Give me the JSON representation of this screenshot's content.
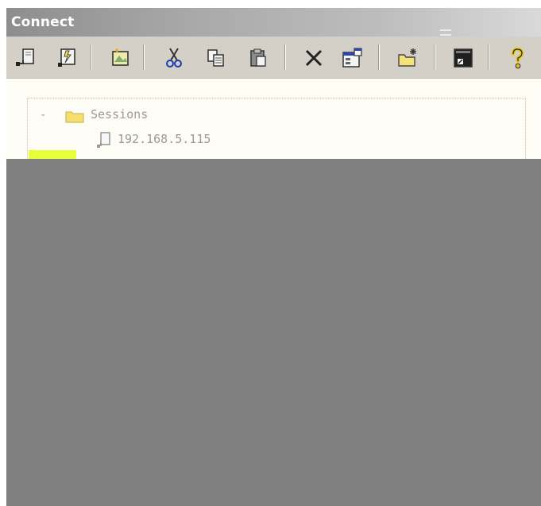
{
  "window": {
    "title": "Connect"
  },
  "toolbar": {
    "buttons": [
      {
        "name": "connect-icon"
      },
      {
        "name": "quick-connect-icon"
      },
      {
        "name": "connect-in-tab-icon"
      },
      {
        "name": "cut-icon"
      },
      {
        "name": "copy-icon"
      },
      {
        "name": "paste-icon"
      },
      {
        "name": "delete-icon"
      },
      {
        "name": "properties-icon"
      },
      {
        "name": "new-folder-icon"
      },
      {
        "name": "terminal-icon"
      },
      {
        "name": "help-icon"
      }
    ]
  },
  "tree": {
    "root_expander": "-",
    "root_label": "Sessions",
    "items": [
      {
        "label": "192.168.5.115"
      }
    ]
  },
  "colors": {
    "title_bar_start": "#8e8e8e",
    "toolbar_bg": "#d4d0c8",
    "tree_bg": "#fdfdf6",
    "overlay": "#808080",
    "highlight": "#e7ff3a"
  }
}
